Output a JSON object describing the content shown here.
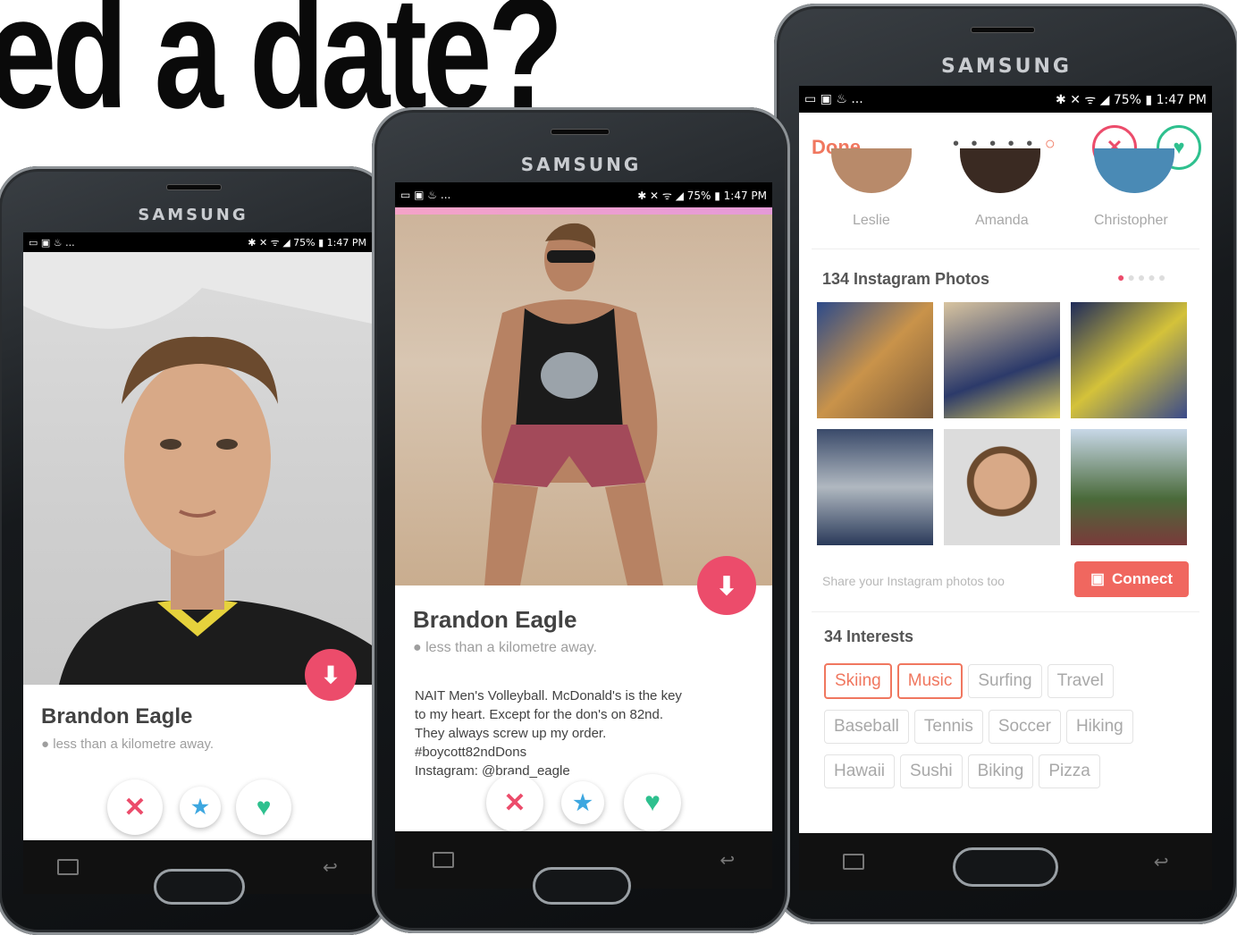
{
  "headline": "ed a date?",
  "colors": {
    "accent": "#ec4c6b",
    "orange": "#f0775f",
    "green": "#2ec08e",
    "star": "#3da7e0"
  },
  "phone_brand": "SAMSUNG",
  "status": {
    "left": "▭ ▣ ♨ ...",
    "right": "✱ ✕ ᯤ ◢ 75% ▮ 1:47 PM"
  },
  "left_phone": {
    "name": "Brandon Eagle",
    "distance": "less than a kilometre away."
  },
  "middle_phone": {
    "name": "Brandon Eagle",
    "distance": "less than a kilometre away.",
    "bio": [
      "NAIT Men's Volleyball. McDonald's is the key",
      "to my heart. Except for the don's on 82nd.",
      "They always screw up my order.",
      "#boycott82ndDons",
      "Instagram: @brand_eagle"
    ]
  },
  "right_phone": {
    "done_label": "Done",
    "friends": [
      "Leslie",
      "Amanda",
      "Christopher"
    ],
    "instagram_title": "134 Instagram Photos",
    "share_text": "Share your Instagram photos too",
    "connect_label": "Connect",
    "interests_title": "34 Interests",
    "interests": [
      {
        "label": "Skiing",
        "selected": true
      },
      {
        "label": "Music",
        "selected": true
      },
      {
        "label": "Surfing",
        "selected": false
      },
      {
        "label": "Travel",
        "selected": false
      },
      {
        "label": "Baseball",
        "selected": false
      },
      {
        "label": "Tennis",
        "selected": false
      },
      {
        "label": "Soccer",
        "selected": false
      },
      {
        "label": "Hiking",
        "selected": false
      },
      {
        "label": "Hawaii",
        "selected": false
      },
      {
        "label": "Sushi",
        "selected": false
      },
      {
        "label": "Biking",
        "selected": false
      },
      {
        "label": "Pizza",
        "selected": false
      }
    ]
  }
}
